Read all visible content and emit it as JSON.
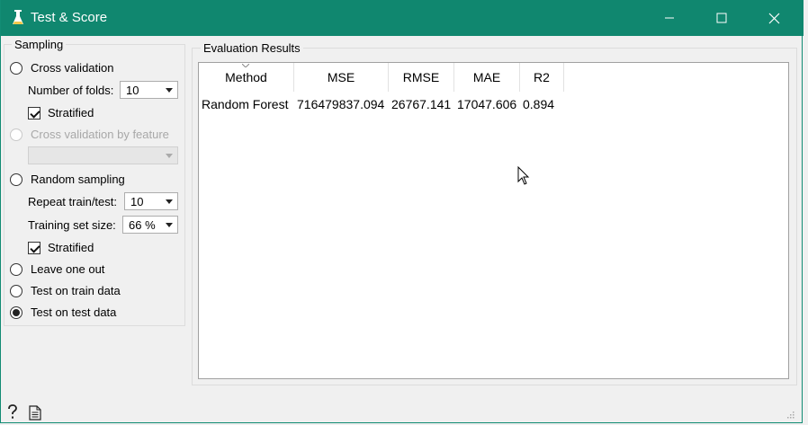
{
  "window": {
    "title": "Test & Score",
    "icon": "flask-icon",
    "controls": [
      "minimize-icon",
      "maximize-icon",
      "close-icon"
    ]
  },
  "sampling": {
    "title": "Sampling",
    "cross_validation": {
      "label": "Cross validation",
      "checked": false
    },
    "folds": {
      "label": "Number of folds:",
      "value": "10"
    },
    "stratified_1": {
      "label": "Stratified",
      "checked": true
    },
    "cv_by_feature": {
      "label": "Cross validation by feature",
      "disabled": true,
      "value": ""
    },
    "random_sampling": {
      "label": "Random sampling",
      "checked": false
    },
    "repeat": {
      "label": "Repeat train/test:",
      "value": "10"
    },
    "train_size": {
      "label": "Training set size:",
      "value": "66 %"
    },
    "stratified_2": {
      "label": "Stratified",
      "checked": true
    },
    "leave_one_out": {
      "label": "Leave one out",
      "checked": false
    },
    "test_on_train": {
      "label": "Test on train data",
      "checked": false
    },
    "test_on_test": {
      "label": "Test on test data",
      "checked": true
    }
  },
  "results": {
    "title": "Evaluation Results",
    "columns": [
      "Method",
      "MSE",
      "RMSE",
      "MAE",
      "R2"
    ],
    "rows": [
      [
        "Random Forest",
        "716479837.094",
        "26767.141",
        "17047.606",
        "0.894"
      ]
    ]
  },
  "footer": {
    "icons": [
      "help-icon",
      "report-icon",
      "resize-grip-icon"
    ]
  },
  "colors": {
    "titlebar": "#10876f",
    "window_bg": "#f0f0f0",
    "table_bg": "#ffffff"
  }
}
